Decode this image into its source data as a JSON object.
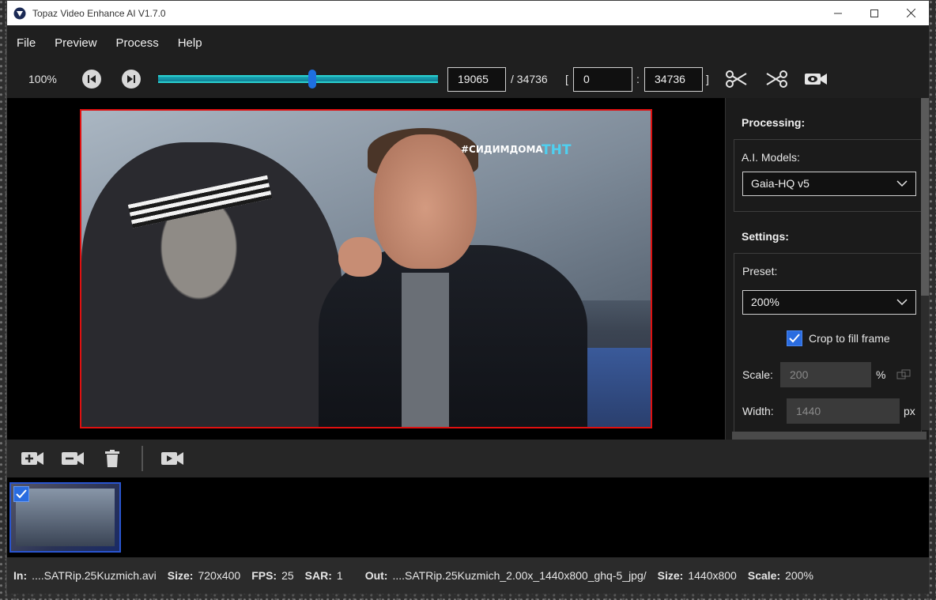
{
  "window": {
    "title": "Topaz Video Enhance AI V1.7.0"
  },
  "menu": {
    "items": [
      "File",
      "Preview",
      "Process",
      "Help"
    ]
  },
  "toolbar": {
    "zoom": "100%",
    "current_frame": "19065",
    "total_frames": "/ 34736",
    "range_open": "[",
    "range_start": "0",
    "range_sep": ":",
    "range_end": "34736",
    "range_close": "]",
    "slider_position_fraction": 0.55
  },
  "video": {
    "watermark_text": "#СИДИМДОМА",
    "channel_logo": "ТНТ"
  },
  "right_panel": {
    "processing_heading": "Processing:",
    "ai_models_label": "A.I. Models:",
    "ai_model_value": "Gaia-HQ v5",
    "settings_heading": "Settings:",
    "preset_label": "Preset:",
    "preset_value": "200%",
    "crop_label": "Crop to fill frame",
    "crop_checked": true,
    "scale_label": "Scale:",
    "scale_value": "200",
    "scale_unit": "%",
    "width_label": "Width:",
    "width_value": "1440",
    "width_unit": "px"
  },
  "status": {
    "in_label": "In:",
    "in_value": "....SATRip.25Kuzmich.avi",
    "size_label": "Size:",
    "size_value": "720x400",
    "fps_label": "FPS:",
    "fps_value": "25",
    "sar_label": "SAR:",
    "sar_value": "1",
    "out_label": "Out:",
    "out_value": "....SATRip.25Kuzmich_2.00x_1440x800_ghq-5_jpg/",
    "out_size_label": "Size:",
    "out_size_value": "1440x800",
    "scale_label": "Scale:",
    "scale_value": "200%"
  },
  "colors": {
    "accent": "#2a6ce0",
    "frame_border": "#e01010",
    "slider": "#1aa5b4"
  }
}
